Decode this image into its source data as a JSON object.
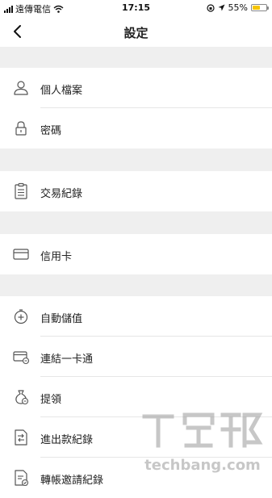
{
  "status_bar": {
    "carrier": "遠傳電信",
    "time": "17:15",
    "battery_percent": "55%",
    "battery_level": 0.55
  },
  "nav": {
    "title": "設定",
    "back_icon": "chevron-left-icon"
  },
  "sections": [
    {
      "items": [
        {
          "label": "個人檔案",
          "icon": "user-icon"
        },
        {
          "label": "密碼",
          "icon": "lock-icon"
        }
      ]
    },
    {
      "items": [
        {
          "label": "交易紀錄",
          "icon": "clipboard-icon"
        }
      ]
    },
    {
      "items": [
        {
          "label": "信用卡",
          "icon": "credit-card-icon"
        }
      ]
    },
    {
      "items": [
        {
          "label": "自動儲值",
          "icon": "add-circle-icon"
        },
        {
          "label": "連結一卡通",
          "icon": "card-link-icon"
        },
        {
          "label": "提領",
          "icon": "money-bag-icon"
        },
        {
          "label": "進出款紀錄",
          "icon": "document-transfer-icon"
        },
        {
          "label": "轉帳邀請紀錄",
          "icon": "document-invite-icon"
        }
      ]
    }
  ],
  "watermark": {
    "brand": "T客邦",
    "text": "techbang.com"
  }
}
